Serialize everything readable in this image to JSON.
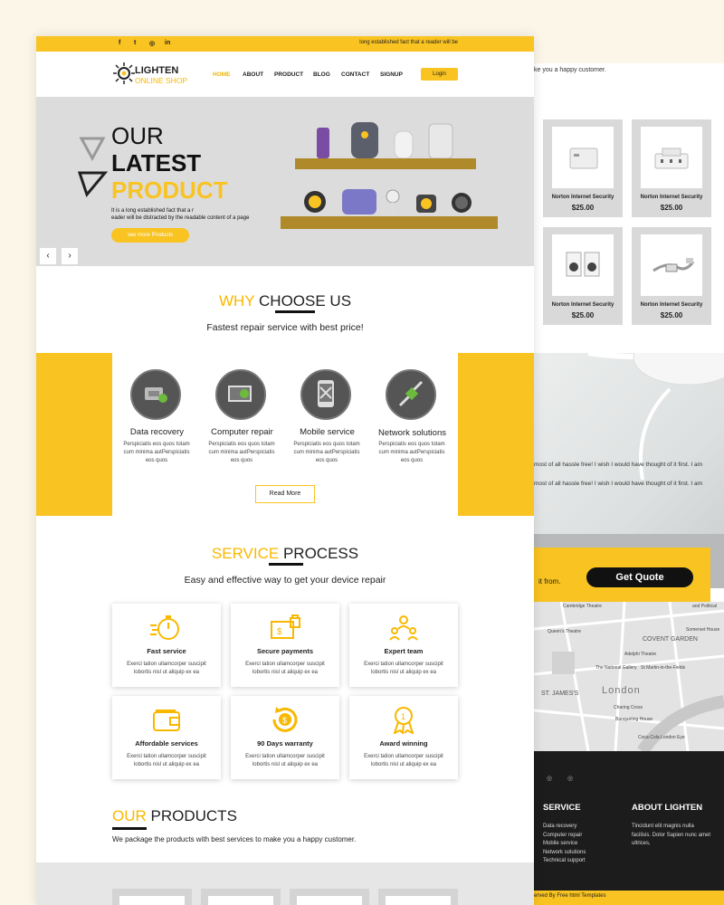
{
  "topbar": {
    "social": [
      "f",
      "t",
      "◎",
      "in"
    ],
    "tagline": "long established fact that a reader will be"
  },
  "logo": {
    "brand": "LIGHTEN",
    "sub": "ONLINE SHOP"
  },
  "nav": {
    "items": [
      "HOME",
      "ABOUT",
      "PRODUCT",
      "BLOG",
      "CONTACT",
      "SIGNUP"
    ],
    "login": "Login"
  },
  "hero": {
    "line1": "OUR",
    "line2": "LATEST",
    "line3": "PRODUCT",
    "desc1": "It is a long established fact that a r",
    "desc2": "eader will be distracted by the readable content of a page",
    "button": "see more Products",
    "prev": "‹",
    "next": "›"
  },
  "why": {
    "title_a": "WHY",
    "title_b": "CHOOSE US",
    "subtitle": "Fastest repair service with best price!",
    "features": [
      {
        "title": "Data recovery",
        "desc": "Perspiciatis eos quos totam cum minima autPerspiciatis eos quos"
      },
      {
        "title": "Computer repair",
        "desc": "Perspiciatis eos quos totam cum minima autPerspiciatis eos quos"
      },
      {
        "title": "Mobile service",
        "desc": "Perspiciatis eos quos totam cum minima autPerspiciatis eos quos"
      },
      {
        "title": "Network solutions",
        "desc": "Perspiciatis eos quos totam cum minima autPerspiciatis eos quos"
      }
    ],
    "read_more": "Read More"
  },
  "process": {
    "title_a": "SERVICE",
    "title_b": "PROCESS",
    "subtitle": "Easy and effective way to get your device repair",
    "cards": [
      {
        "title": "Fast service",
        "desc": "Exerci tation ullamcorper suscipit lobortis nisl ut aliquip ex ea"
      },
      {
        "title": "Secure payments",
        "desc": "Exerci tation ullamcorper suscipit lobortis nisl ut aliquip ex ea"
      },
      {
        "title": "Expert team",
        "desc": "Exerci tation ullamcorper suscipit lobortis nisl ut aliquip ex ea"
      },
      {
        "title": "Affordable services",
        "desc": "Exerci tation ullamcorper suscipit lobortis nisl ut aliquip ex ea"
      },
      {
        "title": "90 Days warranty",
        "desc": "Exerci tation ullamcorper suscipit lobortis nisl ut aliquip ex ea"
      },
      {
        "title": "Award winning",
        "desc": "Exerci tation ullamcorper suscipit lobortis nisl ut aliquip ex ea"
      }
    ]
  },
  "products": {
    "title_a": "OUR",
    "title_b": "PRODUCTS",
    "subtitle": "We package the products with best services to make you a happy customer."
  },
  "back_page": {
    "top_text": "ke you a happy customer.",
    "cards": [
      {
        "name": "Norton Internet Security",
        "price": "$25.00"
      },
      {
        "name": "Norton Internet Security",
        "price": "$25.00"
      },
      {
        "name": "Norton Internet Security",
        "price": "$25.00"
      },
      {
        "name": "Norton Internet Security",
        "price": "$25.00"
      }
    ],
    "quote1": "most of all hassle free! I wish I would have thought of it first. I am",
    "quote2": "most of all hassle free! I wish I would have thought of it first. I am",
    "cta_text": "it from.",
    "cta_button": "Get Quote",
    "map_labels": [
      "Cambridge Theatre",
      "and Political",
      "Queen's Theatre",
      "COVENT GARDEN",
      "Adelphi Theatre",
      "The National Gallery",
      "St Martin-in-the-Fields",
      "ST. JAMES'S",
      "London",
      "Banqueting House",
      "Coca-Cola London Eye",
      "Somerset House",
      "Charing Cross"
    ],
    "footer": {
      "service_title": "SERVICE",
      "service_items": [
        "Data recovery",
        "Computer repair",
        "Mobile service",
        "Network solutions",
        "Technical support"
      ],
      "about_title": "ABOUT LIGHTEN",
      "about_text": "Tincidunt elit magnis nulla facilisis. Dolor Sapien nunc amet ultrices,",
      "copyright": "erved By Free html Templates"
    }
  },
  "colors": {
    "accent": "#f9c321",
    "dark": "#1c1c1c",
    "hero_bg": "#dcdcdc"
  }
}
